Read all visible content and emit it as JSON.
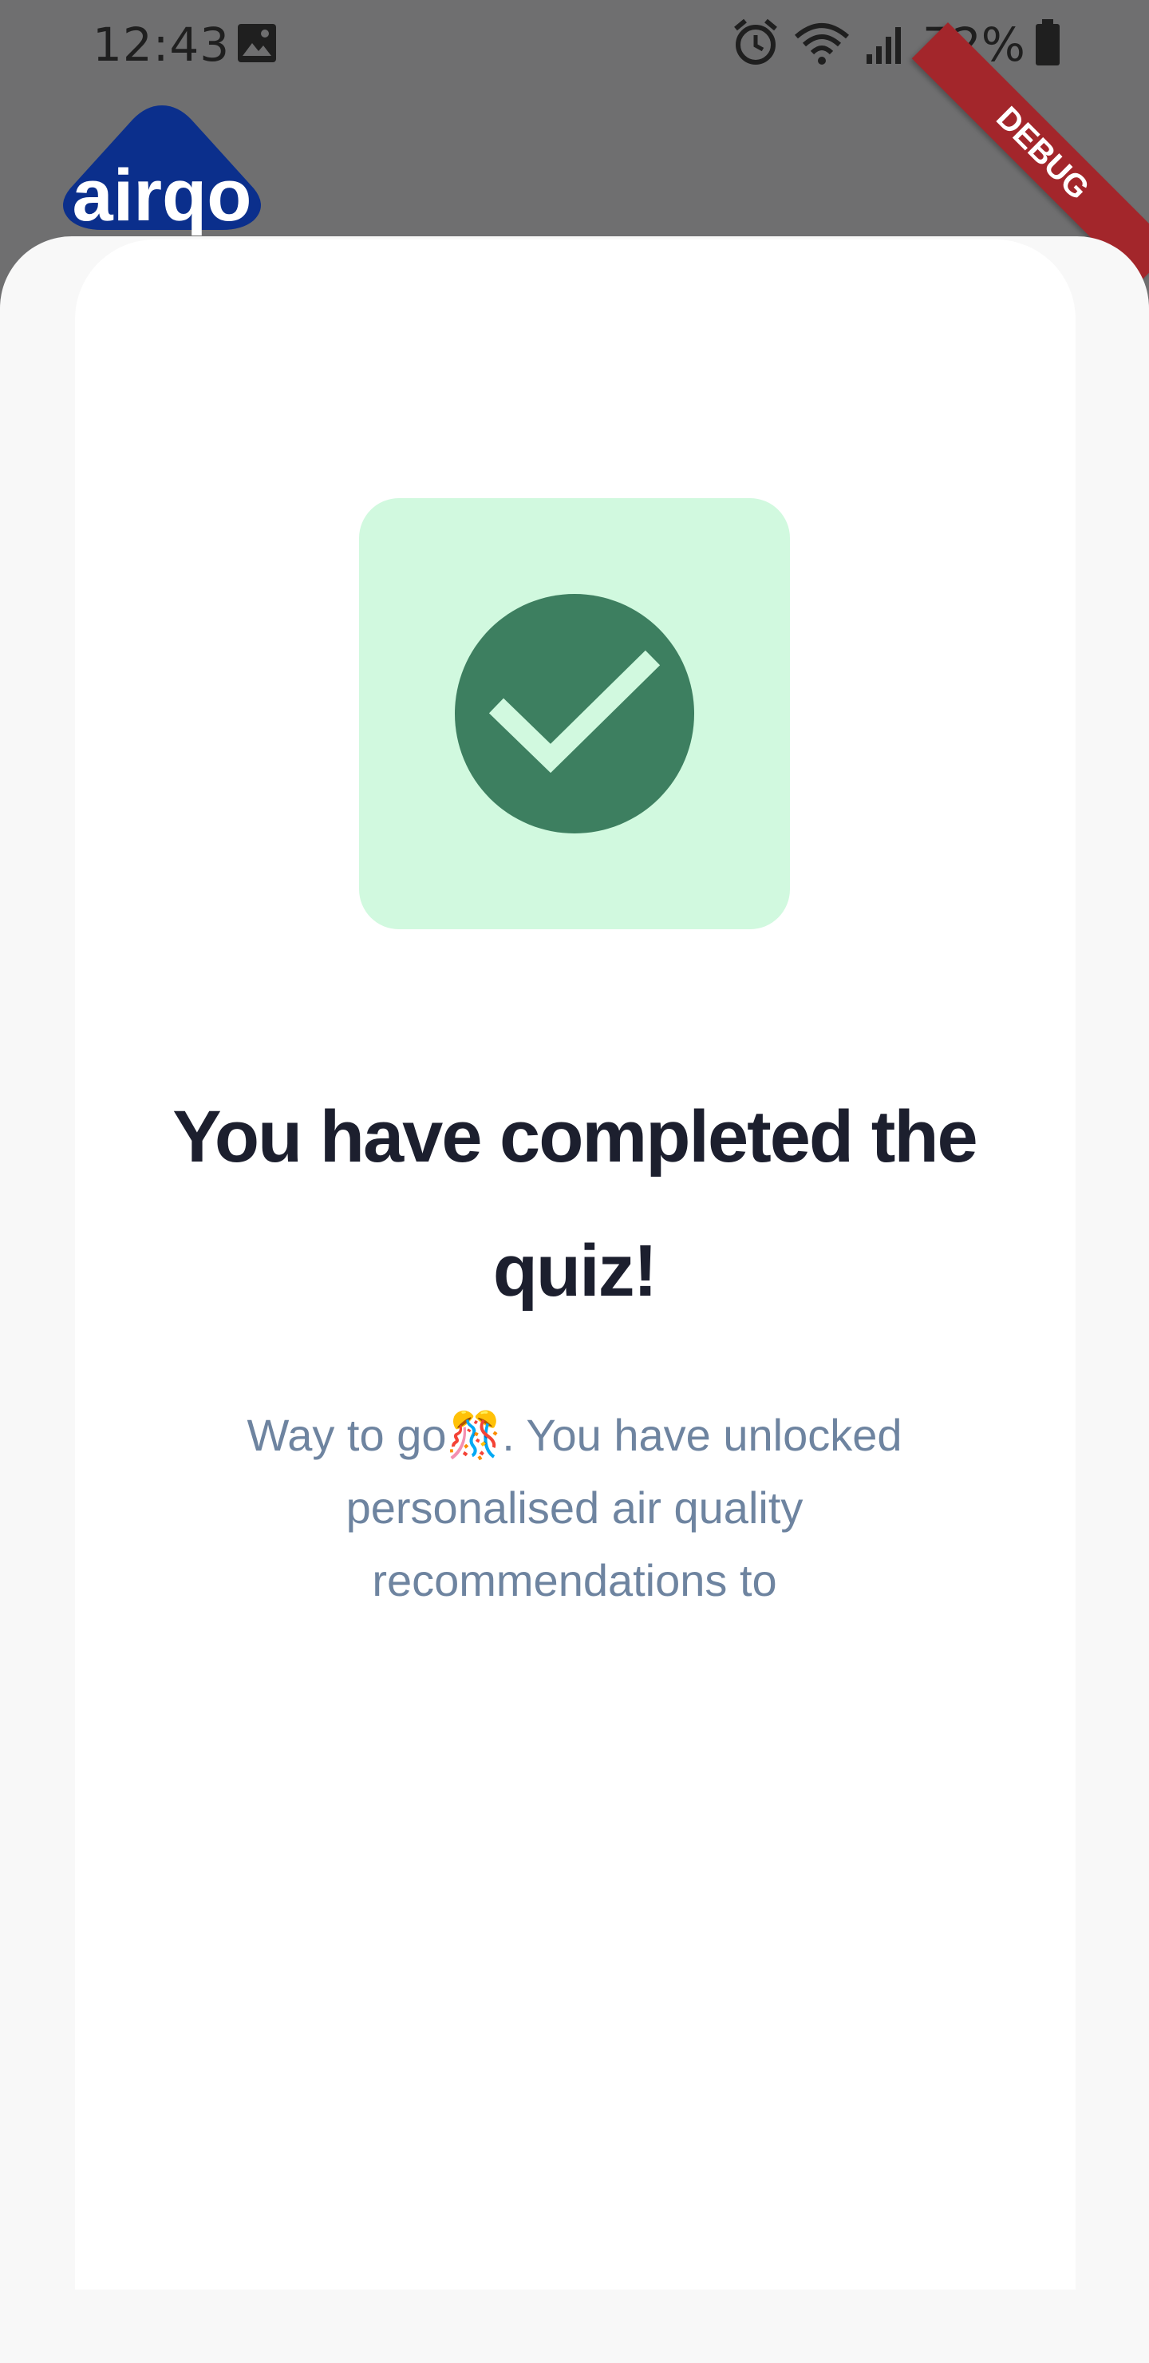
{
  "status_bar": {
    "time": "12:43",
    "battery": "72%",
    "icons": [
      "image-icon",
      "alarm-icon",
      "wifi-icon",
      "signal-icon",
      "battery-icon"
    ]
  },
  "app": {
    "logo_text": "airqo",
    "brand_color": "#0b2f8c"
  },
  "debug_banner": "DEBUG",
  "completion": {
    "title": "You have completed the quiz!",
    "message": "Way to go🎊. You have unlocked personalised air quality recommendations to",
    "icon": "check-circle-icon",
    "icon_color": "#3d7f60",
    "icon_bg_color": "#d1f9df"
  }
}
